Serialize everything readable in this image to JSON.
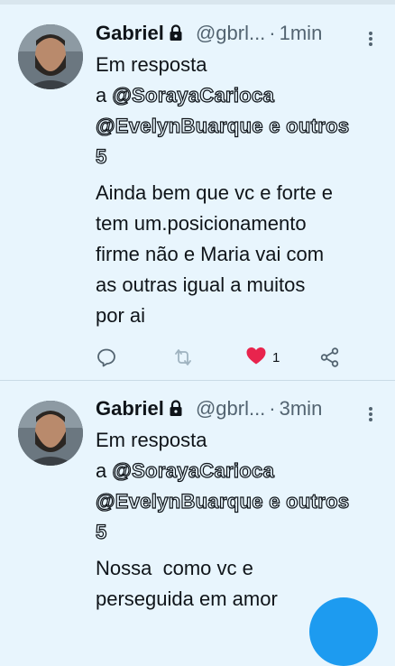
{
  "tweets": [
    {
      "name": "Gabriel",
      "handle": "@gbrl...",
      "separator": "·",
      "time": "1min",
      "reply_prefix": "Em resposta",
      "reply_a": "a",
      "mention1": "@SorayaCarioca",
      "mention2": "@EvelynBuarque e outros",
      "others_count": "5",
      "text_lines": [
        "Ainda bem que vc e forte e",
        "tem um.posicionamento",
        "firme não e Maria vai com",
        "as outras igual a muitos",
        "por ai"
      ],
      "like_count": "1",
      "liked": true
    },
    {
      "name": "Gabriel",
      "handle": "@gbrl...",
      "separator": "·",
      "time": "3min",
      "reply_prefix": "Em resposta",
      "reply_a": "a",
      "mention1": "@SorayaCarioca",
      "mention2": "@EvelynBuarque e outros",
      "others_count": "5",
      "text_lines": [
        "Nossa  como vc e",
        "perseguida em amor"
      ]
    }
  ],
  "colors": {
    "background": "#e8f5fd",
    "like": "#f91880",
    "icon": "#536471",
    "accent": "#1d9bf0"
  },
  "icons": [
    "lock-icon",
    "more-icon",
    "reply-icon",
    "retweet-icon",
    "heart-icon",
    "share-icon"
  ]
}
